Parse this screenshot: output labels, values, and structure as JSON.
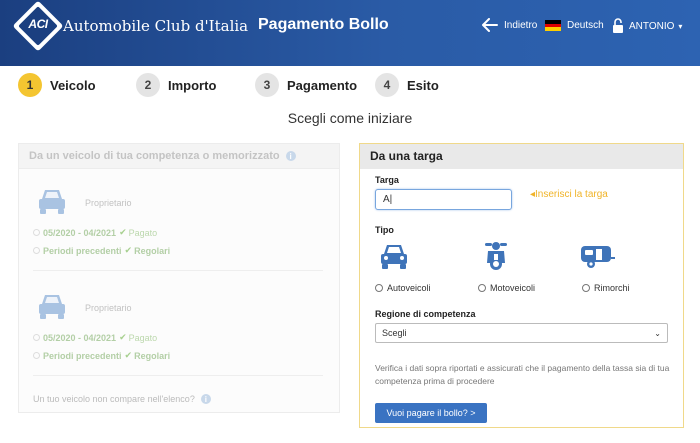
{
  "header": {
    "logo_text": "ACI",
    "brand": "Automobile Club d'Italia",
    "title": "Pagamento Bollo",
    "back_label": "Indietro",
    "language_label": "Deutsch",
    "user_label": "ANTONIO"
  },
  "steps": [
    {
      "number": "1",
      "label": "Veicolo",
      "active": true
    },
    {
      "number": "2",
      "label": "Importo",
      "active": false
    },
    {
      "number": "3",
      "label": "Pagamento",
      "active": false
    },
    {
      "number": "4",
      "label": "Esito",
      "active": false
    }
  ],
  "subtitle": "Scegli come iniziare",
  "left_panel": {
    "heading": "Da un veicolo di tua competenza o memorizzato",
    "vehicles": [
      {
        "owner": "Proprietario",
        "dates": "05/2020 - 04/2021",
        "paid": "Pagato",
        "previous": "Periodi precedenti",
        "status": "Regolari"
      },
      {
        "owner": "Proprietario",
        "dates": "05/2020 - 04/2021",
        "paid": "Pagato",
        "previous": "Periodi precedenti",
        "status": "Regolari"
      }
    ],
    "footer": "Un tuo veicolo non compare nell'elenco?"
  },
  "right_panel": {
    "heading": "Da una targa",
    "targa_label": "Targa",
    "targa_value": "A|",
    "targa_hint": "Inserisci la targa",
    "tipo_label": "Tipo",
    "types": [
      {
        "label": "Autoveicoli",
        "icon": "car-icon"
      },
      {
        "label": "Motoveicoli",
        "icon": "scooter-icon"
      },
      {
        "label": "Rimorchi",
        "icon": "trailer-icon"
      }
    ],
    "regione_label": "Regione di competenza",
    "regione_selected": "Scegli",
    "notice": "Verifica i dati sopra riportati e assicurati che il pagamento della tassa sia di tua competenza prima di procedere",
    "cta_label": "Vuoi pagare il bollo? >"
  },
  "colors": {
    "header_blue": "#1b3f80",
    "active_step": "#f4c531",
    "button_blue": "#3a73c2",
    "hint_yellow": "#f0b429",
    "vehicle_icon_blue": "#3f74b9"
  }
}
